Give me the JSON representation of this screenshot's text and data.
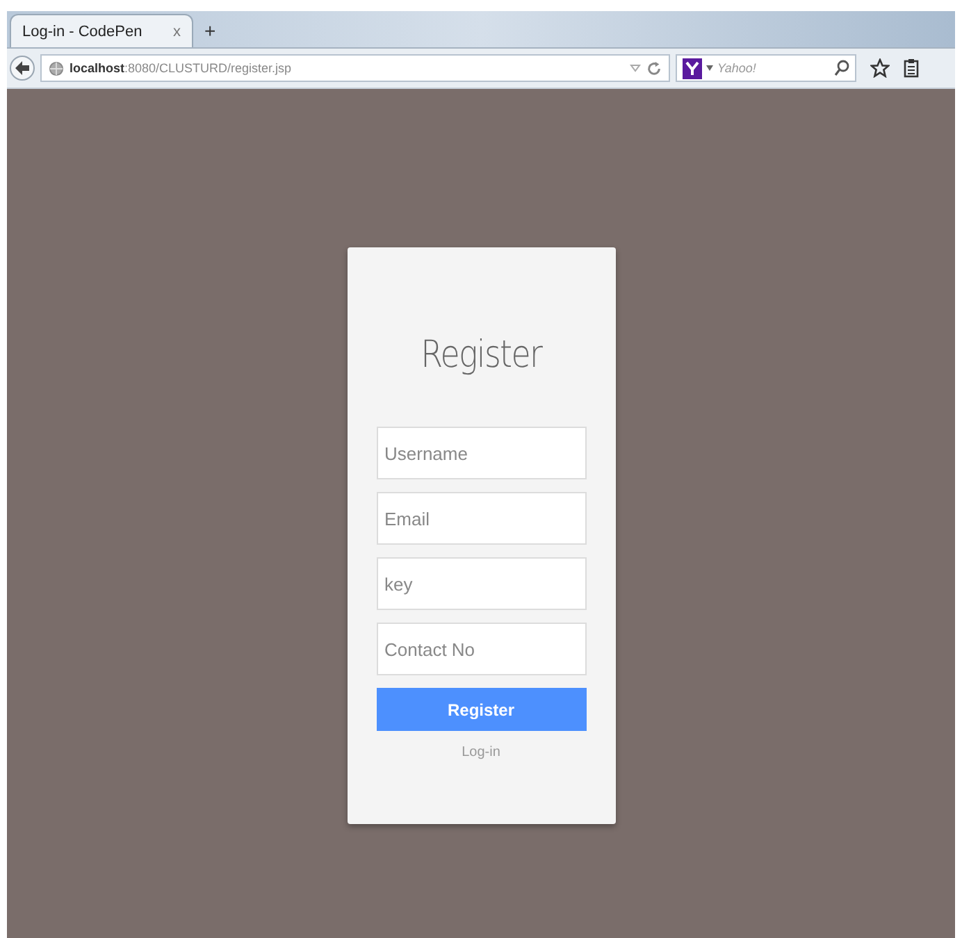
{
  "browser": {
    "tabs": [
      {
        "title": "Log-in - CodePen",
        "close": "x",
        "selected": true
      }
    ],
    "new_tab": "+",
    "address": {
      "host": "localhost",
      "path": ":8080/CLUSTURD/register.jsp"
    },
    "search": {
      "placeholder": "Yahoo!"
    }
  },
  "form": {
    "title": "Register",
    "fields": [
      {
        "placeholder": "Username"
      },
      {
        "placeholder": "Email"
      },
      {
        "placeholder": "key"
      },
      {
        "placeholder": "Contact No"
      }
    ],
    "button": "Register",
    "link": "Log-in"
  }
}
